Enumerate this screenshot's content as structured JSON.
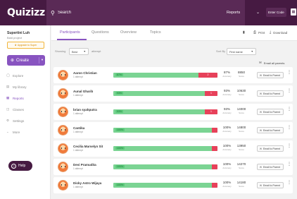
{
  "topbar": {
    "logo": "Quizizz",
    "search_placeholder": "Search",
    "reports_label": "Reports",
    "enter_code_label": "Enter Code"
  },
  "sidebar": {
    "user_name": "Supertini Luh",
    "user_role": "Bald project",
    "upgrade_label": "Upgrade to Super",
    "create_label": "Create",
    "items": [
      {
        "label": "Explore",
        "icon": "compass-icon"
      },
      {
        "label": "My library",
        "icon": "library-icon"
      },
      {
        "label": "Reports",
        "icon": "reports-icon",
        "active": true
      },
      {
        "label": "Classes",
        "icon": "classes-icon"
      },
      {
        "label": "Settings",
        "icon": "gear-icon"
      },
      {
        "label": "More",
        "icon": "chevron-down-icon"
      }
    ],
    "help_label": "Help"
  },
  "main": {
    "tabs": [
      "Participants",
      "Questions",
      "Overview",
      "Topics"
    ],
    "active_tab": "Participants",
    "print_label": "Print",
    "download_label": "Download",
    "showing_label": "Showing",
    "showing_value": "Best",
    "attempt_label": "attempt",
    "sort_label": "Sort By",
    "sort_value": "First name",
    "email_all_label": "Email all parents"
  },
  "participants": [
    {
      "name": "Aaron Christian",
      "attempts": "1 attempt",
      "correct_pct": "87%",
      "incorrect_label": "2",
      "accuracy": "87%",
      "score": "8850",
      "accuracy_label": "Accuracy",
      "score_label": "Score",
      "email_label": "Email to Parent",
      "progress": 0.87
    },
    {
      "name": "Aunal Gharib",
      "attempts": "1 attempt",
      "correct_pct": "93%",
      "incorrect_label": "1",
      "accuracy": "93%",
      "score": "10630",
      "accuracy_label": "Accuracy",
      "score_label": "Score",
      "email_label": "Email to Parent",
      "progress": 0.93
    },
    {
      "name": "brian syahputra",
      "attempts": "1 attempt",
      "correct_pct": "93%",
      "incorrect_label": "1",
      "accuracy": "93%",
      "score": "14000",
      "accuracy_label": "Accuracy",
      "score_label": "Score",
      "email_label": "Email to Parent",
      "progress": 0.93
    },
    {
      "name": "Cantika",
      "attempts": "1 attempt",
      "correct_pct": "100%",
      "incorrect_label": "",
      "accuracy": "100%",
      "score": "14800",
      "accuracy_label": "Accuracy",
      "score_label": "Score",
      "email_label": "Email to Parent",
      "progress": 1.0
    },
    {
      "name": "Cecilia Marselyn Sit",
      "attempts": "1 attempt",
      "correct_pct": "100%",
      "incorrect_label": "",
      "accuracy": "100%",
      "score": "13950",
      "accuracy_label": "Accuracy",
      "score_label": "Score",
      "email_label": "Email to Parent",
      "progress": 1.0
    },
    {
      "name": "Devi Pramudita",
      "attempts": "1 attempt",
      "correct_pct": "100%",
      "incorrect_label": "",
      "accuracy": "100%",
      "score": "14270",
      "accuracy_label": "Accuracy",
      "score_label": "Score",
      "email_label": "Email to Parent",
      "progress": 1.0
    },
    {
      "name": "Dicky Astro Wijaya",
      "attempts": "1 attempt",
      "correct_pct": "100%",
      "incorrect_label": "",
      "accuracy": "100%",
      "score": "14180",
      "accuracy_label": "Accuracy",
      "score_label": "Score",
      "email_label": "Email to Parent",
      "progress": 1.0
    }
  ],
  "colors": {
    "brand": "#461a42",
    "accent": "#8854c0",
    "correct": "#7bd493",
    "incorrect": "#e7415a"
  }
}
